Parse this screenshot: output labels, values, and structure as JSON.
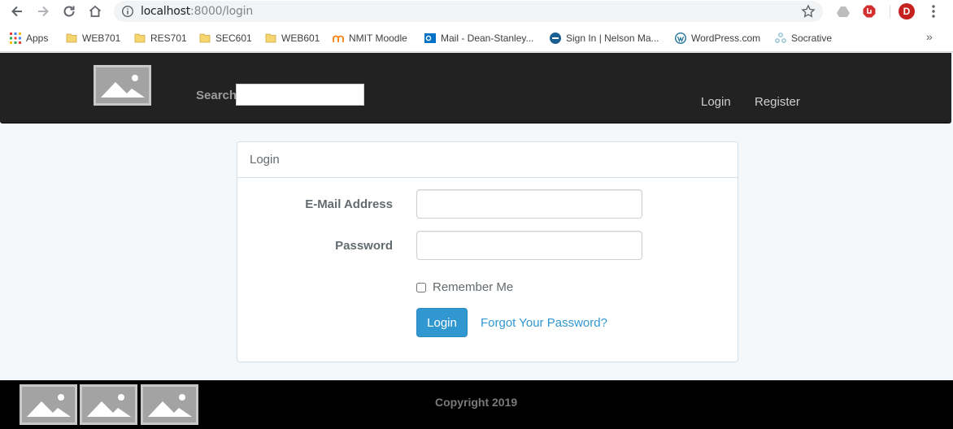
{
  "browser": {
    "url_host": "localhost",
    "url_rest": ":8000/login",
    "avatar_letter": "D"
  },
  "bookmarks": {
    "items": [
      {
        "label": "Apps",
        "icon": "apps-grid-icon"
      },
      {
        "label": "WEB701",
        "icon": "folder-icon"
      },
      {
        "label": "RES701",
        "icon": "folder-icon"
      },
      {
        "label": "SEC601",
        "icon": "folder-icon"
      },
      {
        "label": "WEB601",
        "icon": "folder-icon"
      },
      {
        "label": "NMIT Moodle",
        "icon": "moodle-icon"
      },
      {
        "label": "Mail - Dean-Stanley...",
        "icon": "outlook-icon"
      },
      {
        "label": "Sign In | Nelson Ma...",
        "icon": "site-icon"
      },
      {
        "label": "WordPress.com",
        "icon": "wordpress-icon"
      },
      {
        "label": "Socrative",
        "icon": "socrative-icon"
      }
    ],
    "more": "»"
  },
  "navbar": {
    "search_label": "Search",
    "search_value": "",
    "login": "Login",
    "register": "Register"
  },
  "login_card": {
    "title": "Login",
    "email_label": "E-Mail Address",
    "email_value": "",
    "password_label": "Password",
    "password_value": "",
    "remember_label": "Remember Me",
    "remember_checked": false,
    "submit_label": "Login",
    "forgot_label": "Forgot Your Password?"
  },
  "footer": {
    "copyright": "Copyright 2019"
  },
  "colors": {
    "navbar_bg": "#222222",
    "primary": "#3097d1",
    "page_bg": "#f5f8fa",
    "footer_bg": "#000000"
  }
}
